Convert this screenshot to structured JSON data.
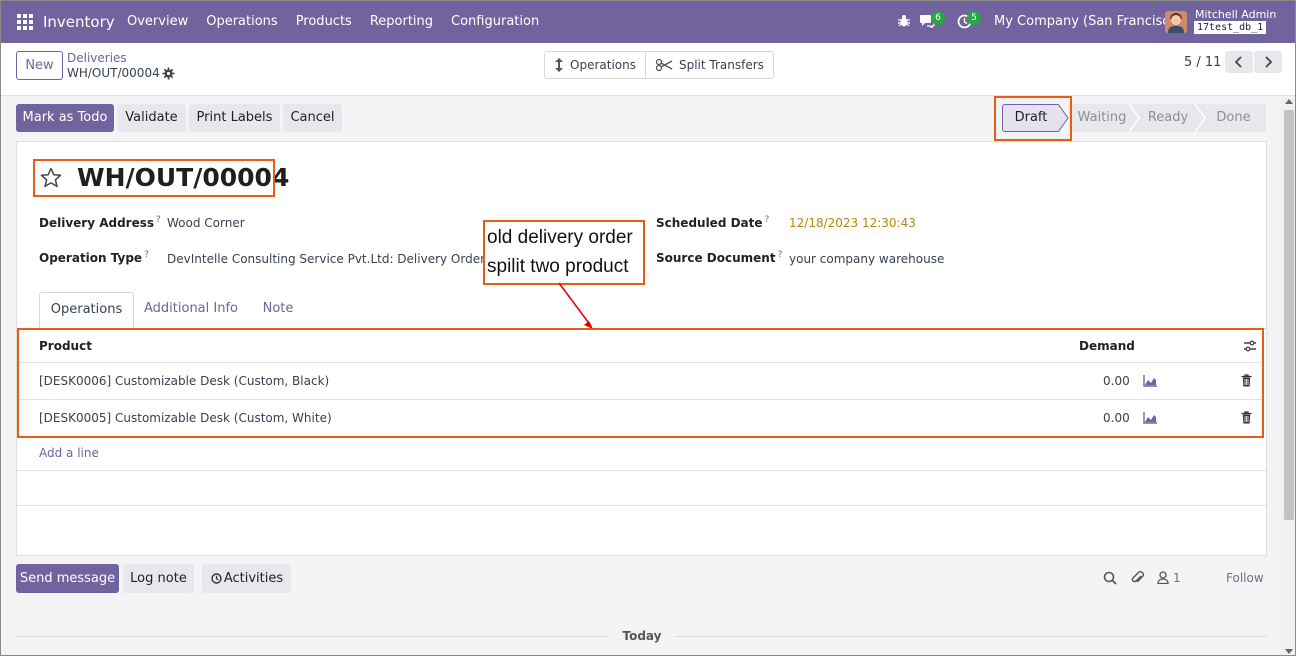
{
  "navbar": {
    "app_name": "Inventory",
    "menu": [
      "Overview",
      "Operations",
      "Products",
      "Reporting",
      "Configuration"
    ],
    "messages_count": "6",
    "activities_count": "5",
    "company": "My Company (San Francisco)",
    "user_name": "Mitchell Admin",
    "db_name": "17test_db_1"
  },
  "control": {
    "new_label": "New",
    "breadcrumb_parent": "Deliveries",
    "breadcrumb_current": "WH/OUT/00004",
    "operations_label": "Operations",
    "split_label": "Split Transfers",
    "pager": "5 / 11"
  },
  "actions": {
    "mark_todo": "Mark as Todo",
    "validate": "Validate",
    "print_labels": "Print Labels",
    "cancel": "Cancel"
  },
  "stages": [
    "Draft",
    "Waiting",
    "Ready",
    "Done"
  ],
  "record": {
    "title": "WH/OUT/00004",
    "delivery_address_label": "Delivery Address",
    "delivery_address": "Wood Corner",
    "operation_type_label": "Operation Type",
    "operation_type": "DevIntelle Consulting Service Pvt.Ltd: Delivery Orders",
    "scheduled_date_label": "Scheduled Date",
    "scheduled_date": "12/18/2023 12:30:43",
    "source_document_label": "Source Document",
    "source_document": "your company warehouse",
    "help_mark": "?"
  },
  "tabs": [
    "Operations",
    "Additional Info",
    "Note"
  ],
  "table": {
    "col_product": "Product",
    "col_demand": "Demand",
    "rows": [
      {
        "product": "[DESK0006] Customizable Desk (Custom, Black)",
        "demand": "0.00"
      },
      {
        "product": "[DESK0005] Customizable Desk (Custom, White)",
        "demand": "0.00"
      }
    ],
    "add_line": "Add a line"
  },
  "annotation": {
    "line1": "old delivery order",
    "line2": "spilit two product"
  },
  "chatter": {
    "send_message": "Send message",
    "log_note": "Log note",
    "activities": "Activities",
    "followers_count": "1",
    "follow": "Follow",
    "today": "Today"
  },
  "colors": {
    "brand": "#71639e",
    "highlight": "#e85d12",
    "badge": "#28a745",
    "date": "#b8860b"
  }
}
